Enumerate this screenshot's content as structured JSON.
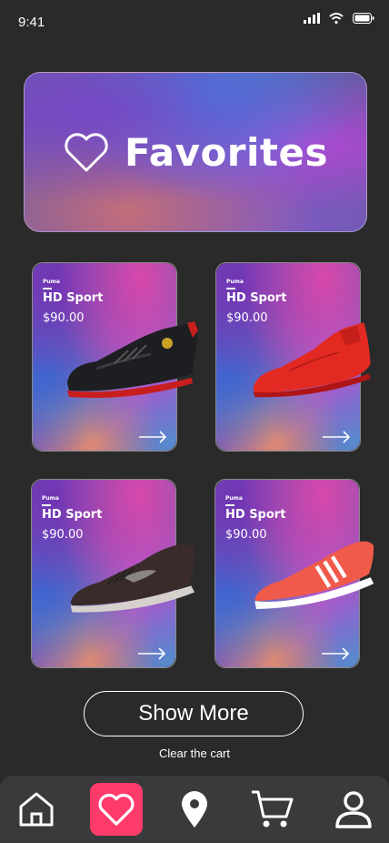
{
  "status_bar": {
    "time": "9:41"
  },
  "hero": {
    "title": "Favorites",
    "icon": "heart-outline-icon"
  },
  "products": [
    {
      "brand": "Puma",
      "name": "HD Sport",
      "price": "$90.00",
      "shoe_color": "#222226",
      "accent": "#c81e1e"
    },
    {
      "brand": "Puma",
      "name": "HD Sport",
      "price": "$90.00",
      "shoe_color": "#e22a22",
      "accent": "#b01515"
    },
    {
      "brand": "Puma",
      "name": "HD Sport",
      "price": "$90.00",
      "shoe_color": "#3a2b2b",
      "accent": "#d6d0cc"
    },
    {
      "brand": "Puma",
      "name": "HD Sport",
      "price": "$90.00",
      "shoe_color": "#f05a4a",
      "accent": "#ffffff"
    }
  ],
  "actions": {
    "show_more": "Show More",
    "clear_cart": "Clear the cart"
  },
  "nav": {
    "items": [
      "home-icon",
      "heart-icon",
      "location-pin-icon",
      "cart-icon",
      "profile-icon"
    ],
    "active": "heart-icon",
    "active_color": "#ff3b6b"
  }
}
